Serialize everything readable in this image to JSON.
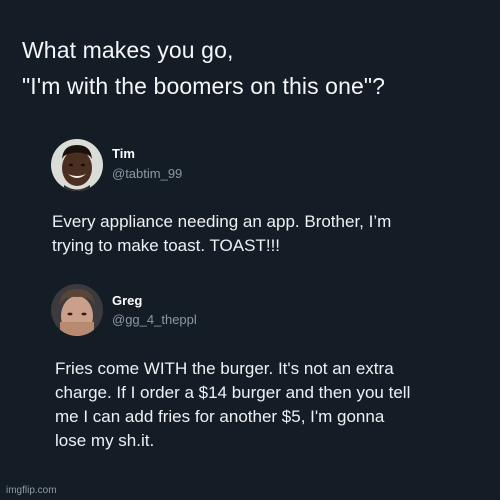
{
  "headline": {
    "line1": "What makes you go,",
    "line2": "\"I'm with the boomers on this one\"?"
  },
  "tweets": [
    {
      "name": "Tim",
      "handle": "@tabtim_99",
      "lines": [
        "Every appliance needing an app. Brother, I’m",
        "trying to make toast. TOAST!!!"
      ]
    },
    {
      "name": "Greg",
      "handle": "@gg_4_theppl",
      "lines": [
        "Fries come WITH the burger. It's not an extra",
        "charge. If I order a $14 burger and then you tell",
        "me I can add fries for another $5, I'm gonna",
        "lose my sh.it."
      ]
    }
  ],
  "watermark": "imgflip.com",
  "colors": {
    "background": "#141d26",
    "text": "#eef1f4",
    "handle": "#8c98a3"
  }
}
